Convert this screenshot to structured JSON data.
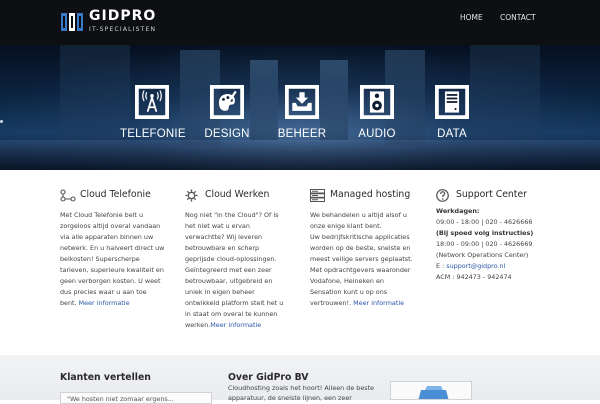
{
  "header": {
    "brand": "GIDPRO",
    "brand_sub": "IT-SPECIALISTEN",
    "nav": [
      "HOME",
      "CONTACT"
    ]
  },
  "hero": {
    "services": [
      {
        "label": "TELEFONIE",
        "icon": "antenna-icon"
      },
      {
        "label": "DESIGN",
        "icon": "paint-palette-icon"
      },
      {
        "label": "BEHEER",
        "icon": "inbox-tray-icon"
      },
      {
        "label": "AUDIO",
        "icon": "speaker-icon"
      },
      {
        "label": "DATA",
        "icon": "server-box-icon"
      }
    ]
  },
  "columns": [
    {
      "title": "Cloud Telefonie",
      "icon": "network-nodes-icon",
      "lines": [
        "Met Cloud Telefonie belt u",
        "zorgeloos altijd overal vandaan",
        "via alle apparaten binnen uw",
        "netwerk. En u halveert direct uw",
        "belkosten! Superscherpe",
        "tarieven, superieure kwaliteit en",
        "geen verborgen kosten. U weet",
        "dus precies waar u aan toe",
        "bent."
      ],
      "link": "Meer informatie"
    },
    {
      "title": "Cloud Werken",
      "icon": "gear-icon",
      "lines": [
        "Nog niet \"in the Cloud\"? Of is",
        "het niet wat u ervan",
        "verwachtte? Wij leveren",
        "betrouwbare en scherp",
        "geprijsde cloud-oplossingen.",
        "Geïntegreerd met een zeer",
        "betrouwbaar, uitgebreid en",
        "uniek in eigen beheer",
        "ontwikkeld platform stelt het u",
        "in staat om overal te kunnen",
        "werken."
      ],
      "link": "Meer informatie"
    },
    {
      "title": "Managed hosting",
      "icon": "server-rack-icon",
      "lines": [
        "We behandelen u altijd alsof u",
        "onze enige klant bent.",
        "Uw bedrijfskritische applicaties",
        "worden op de beste, snelste en",
        "meest veilige servers geplaatst.",
        "Met opdrachtgevers waaronder",
        "Vodafone, Heineken en",
        "Sensation kunt u op ons",
        "vertrouwen!."
      ],
      "link": "Meer informatie"
    }
  ],
  "support": {
    "title": "Support Center",
    "icon": "question-circle-icon",
    "werkdagen_label": "Werkdagen:",
    "line1": "09:00 - 18:00 | 020 - 4626666",
    "spoed_label": "(Bij spoed volg instructies)",
    "line2": "18:00 - 09:00 | 020 - 4626669",
    "noc": "(Network Operations Center)",
    "email_prefix": "E : ",
    "email": "support@gidpro.nl",
    "acm": "ACM : 942473 - 942474"
  },
  "bottom": {
    "klanten_title": "Klanten vertellen",
    "testimonial_text": "\"We hosten niet zomaar ergens...",
    "about_title": "Over GidPro BV",
    "about_lines": [
      "Cloudhosting zoals het hoort! Alleen de beste",
      "apparatuur, de snelste lijnen, een zeer"
    ]
  }
}
